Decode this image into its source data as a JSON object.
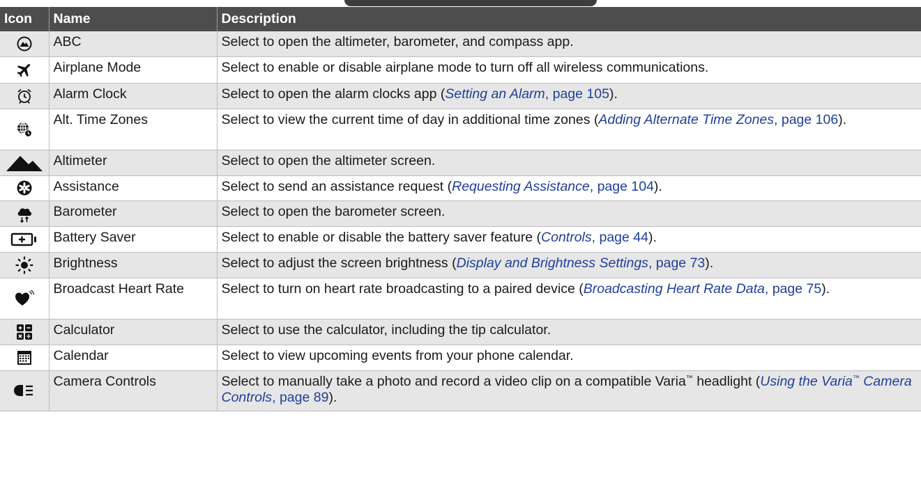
{
  "header": {
    "icon": "Icon",
    "name": "Name",
    "description": "Description"
  },
  "rows": [
    {
      "icon": "altimeter-barometer-compass-icon",
      "name": "ABC",
      "desc_before": "Select to open the altimeter, barometer, and compass app."
    },
    {
      "icon": "airplane-icon",
      "name": "Airplane Mode",
      "desc_before": "Select to enable or disable airplane mode to turn off all wireless communications."
    },
    {
      "icon": "alarm-clock-icon",
      "name": "Alarm Clock",
      "desc_before": "Select to open the alarm clocks app (",
      "link_title": "Setting an Alarm",
      "link_page": ", page 105",
      "desc_after": ")."
    },
    {
      "icon": "globe-clock-icon",
      "name": "Alt. Time Zones",
      "desc_before": "Select to view the current time of day in additional time zones (",
      "link_title": "Adding Alternate Time Zones",
      "link_page": ", page 106",
      "desc_after": ")."
    },
    {
      "icon": "mountain-icon",
      "name": "Altimeter",
      "desc_before": "Select to open the altimeter screen."
    },
    {
      "icon": "assistance-icon",
      "name": "Assistance",
      "desc_before": "Select to send an assistance request (",
      "link_title": "Requesting Assistance",
      "link_page": ", page 104",
      "desc_after": ")."
    },
    {
      "icon": "cloud-pressure-icon",
      "name": "Barometer",
      "desc_before": "Select to open the barometer screen."
    },
    {
      "icon": "battery-plus-icon",
      "name": "Battery Saver",
      "desc_before": "Select to enable or disable the battery saver feature (",
      "link_title": "Controls",
      "link_page": ", page 44",
      "desc_after": ")."
    },
    {
      "icon": "sun-icon",
      "name": "Brightness",
      "desc_before": "Select to adjust the screen brightness (",
      "link_title": "Display and Brightness Settings",
      "link_page": ", page 73",
      "desc_after": ")."
    },
    {
      "icon": "heart-broadcast-icon",
      "name": "Broadcast Heart Rate",
      "desc_before": "Select to turn on heart rate broadcasting to a paired device (",
      "link_title": "Broadcasting Heart Rate Data",
      "link_page": ", page 75",
      "desc_after": ")."
    },
    {
      "icon": "calculator-icon",
      "name": "Calculator",
      "desc_before": "Select to use the calculator, including the tip calculator."
    },
    {
      "icon": "calendar-icon",
      "name": "Calendar",
      "desc_before": "Select to view upcoming events from your phone calendar."
    },
    {
      "icon": "headlight-camera-icon",
      "name": "Camera Controls",
      "desc_before": "Select to manually take a photo and record a video clip on a compatible Varia",
      "desc_tm": "™",
      "desc_mid": " headlight (",
      "link_title": "Using the Varia",
      "link_tm": "™",
      "link_title_after": " Camera Controls",
      "link_page": ", page 89",
      "desc_after": ")."
    }
  ]
}
